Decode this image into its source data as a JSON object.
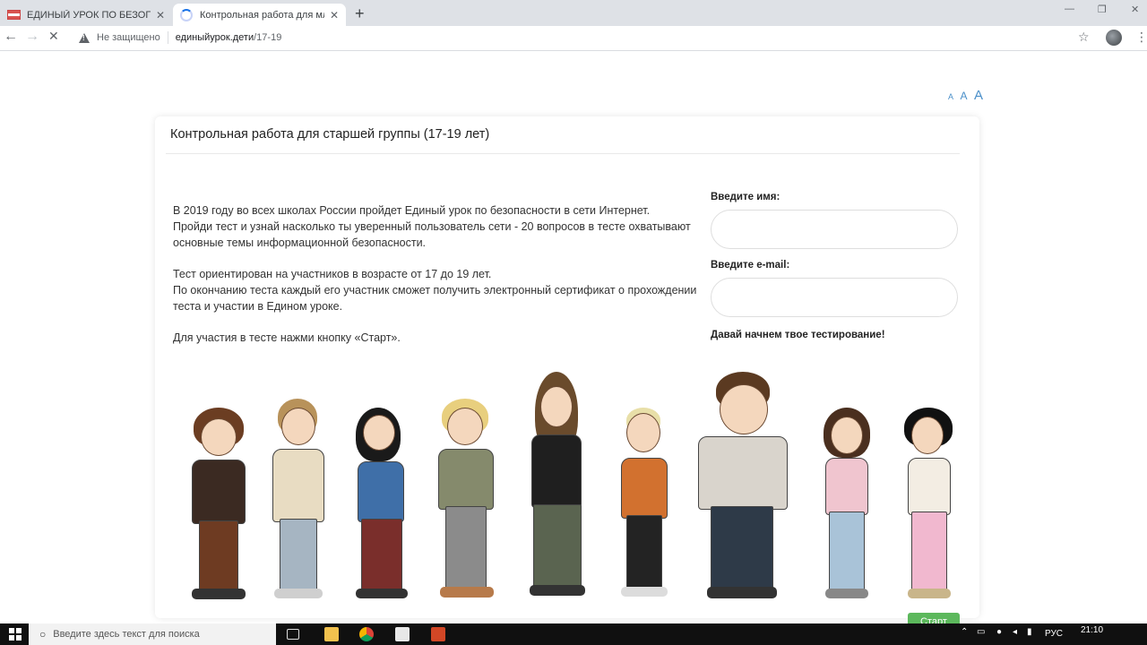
{
  "browser": {
    "tabs": [
      {
        "title": "ЕДИНЫЙ УРОК ПО БЕЗОПАСНОСТ",
        "active": false
      },
      {
        "title": "Контрольная работа для младш",
        "active": true
      }
    ],
    "new_tab": "+",
    "window_controls": {
      "minimize": "—",
      "restore": "❐",
      "close": "✕"
    },
    "nav": {
      "back": "←",
      "forward": "→",
      "reload": "✕"
    },
    "security_label": "Не защищено",
    "url_host": "единыйурок.дети",
    "url_path": "/17-19",
    "bookmark": "☆",
    "menu": "⋮"
  },
  "page": {
    "font_size_controls": [
      "A",
      "A",
      "A"
    ],
    "card_title": "Контрольная работа для старшей группы (17-19 лет)",
    "intro": [
      "В 2019 году во всех школах России пройдет Единый урок по безопасности в сети Интернет.\nПройди тест и узнай насколько ты уверенный пользователь сети - 20 вопросов в тесте охватывают основные темы информационной безопасности.",
      "Тест ориентирован на участников в возрасте от 17 до 19 лет.\nПо окончанию теста каждый его участник сможет получить электронный сертификат о прохождении теста и участии в Едином уроке.",
      "Для участия в тесте нажми кнопку «Старт»."
    ],
    "form": {
      "name_label": "Введите имя:",
      "name_value": "",
      "email_label": "Введите e-mail:",
      "email_value": "",
      "cta": "Давай начнем твое тестирование!"
    },
    "start_button": "Старт"
  },
  "taskbar": {
    "search_placeholder": "Введите здесь текст для поиска",
    "language": "РУС",
    "time": "21:10"
  },
  "colors": {
    "accent_green": "#5cb85c",
    "link_blue": "#4a8fc9",
    "taskbar": "#101010"
  }
}
